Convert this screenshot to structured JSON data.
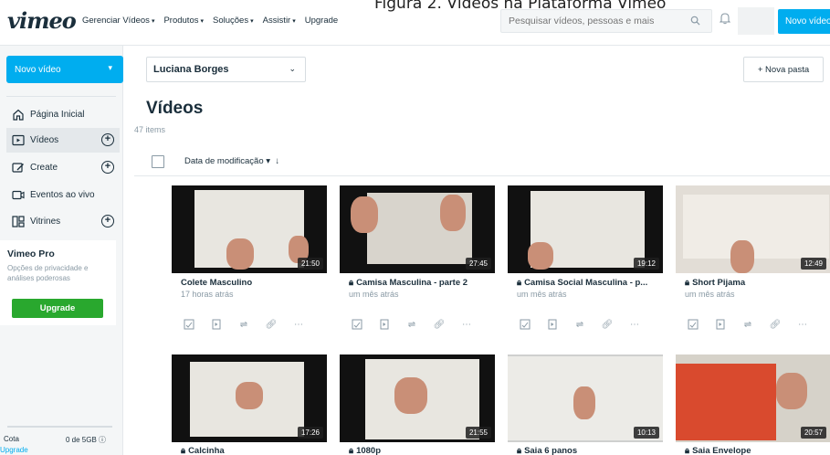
{
  "caption": "Figura 2. Vídeos na Plataforma Vimeo",
  "brand": {
    "logo": "vimeo",
    "accent": "#00adef",
    "green": "#29a82e"
  },
  "nav": {
    "items": [
      "Gerenciar Vídeos",
      "Produtos",
      "Soluções",
      "Assistir",
      "Upgrade"
    ],
    "search_placeholder": "Pesquisar vídeos, pessoas e mais",
    "new_video": "Novo vídeo"
  },
  "sidebar": {
    "new_video": "Novo vídeo",
    "items": [
      {
        "label": "Página Inicial",
        "icon": "home-icon"
      },
      {
        "label": "Vídeos",
        "icon": "video-icon"
      },
      {
        "label": "Create",
        "icon": "create-icon"
      },
      {
        "label": "Eventos ao vivo",
        "icon": "live-icon"
      },
      {
        "label": "Vitrines",
        "icon": "showcase-icon"
      }
    ],
    "pro": {
      "title": "Vimeo Pro",
      "desc": "Opções de privacidade e análises poderosas",
      "upgrade": "Upgrade"
    },
    "quota_label": "Cota",
    "quota_value": "0 de 5GB",
    "upgrade_link": "Upgrade"
  },
  "main": {
    "folder": "Luciana Borges",
    "new_folder": "+ Nova pasta",
    "title": "Vídeos",
    "count": "47 items",
    "sort": "Data de modificação"
  },
  "videos": [
    {
      "title": "Colete Masculino",
      "time": "17 horas atrás",
      "duration": "21:50",
      "locked": false
    },
    {
      "title": "Camisa Masculina - parte 2",
      "time": "um mês atrás",
      "duration": "27:45",
      "locked": true
    },
    {
      "title": "Camisa Social Masculina - p...",
      "time": "um mês atrás",
      "duration": "19:12",
      "locked": true
    },
    {
      "title": "Short Pijama",
      "time": "um mês atrás",
      "duration": "12:49",
      "locked": true
    },
    {
      "title": "Calcinha",
      "time": "",
      "duration": "17:26",
      "locked": true
    },
    {
      "title": "1080p",
      "time": "",
      "duration": "21:55",
      "locked": true
    },
    {
      "title": "Saia 6 panos",
      "time": "",
      "duration": "10:13",
      "locked": true
    },
    {
      "title": "Saia Envelope",
      "time": "",
      "duration": "20:57",
      "locked": true
    }
  ]
}
